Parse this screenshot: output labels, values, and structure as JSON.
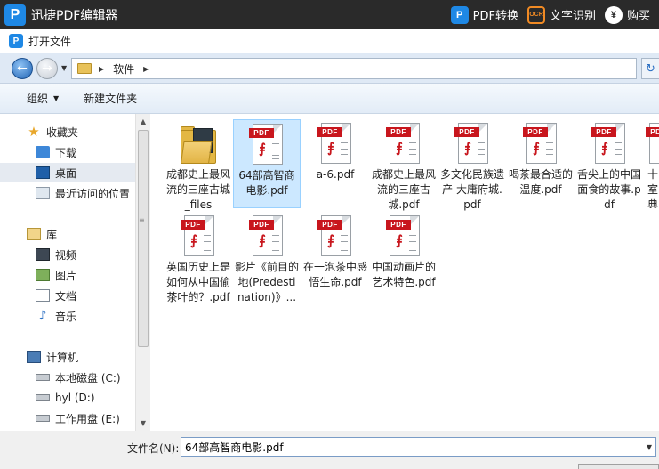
{
  "app": {
    "logo_letter": "P",
    "title": "迅捷PDF编辑器",
    "pdf_convert": "PDF转换",
    "ocr": "文字识别",
    "ocr_badge": "OCR",
    "buy": "购买",
    "buy_symbol": "¥"
  },
  "dialog": {
    "title": "打开文件"
  },
  "address": {
    "path": "软件"
  },
  "toolbar": {
    "organize": "组织",
    "new_folder": "新建文件夹"
  },
  "nav": {
    "items": [
      {
        "label": "收藏夹",
        "icon": "star-icon"
      },
      {
        "label": "下载",
        "icon": "download-folder-icon"
      },
      {
        "label": "桌面",
        "icon": "desktop-icon"
      },
      {
        "label": "最近访问的位置",
        "icon": "recent-places-icon"
      },
      {
        "label": "库",
        "icon": "library-icon"
      },
      {
        "label": "视频",
        "icon": "video-icon"
      },
      {
        "label": "图片",
        "icon": "picture-icon"
      },
      {
        "label": "文档",
        "icon": "document-icon"
      },
      {
        "label": "音乐",
        "icon": "music-icon"
      },
      {
        "label": "计算机",
        "icon": "computer-icon"
      },
      {
        "label": "本地磁盘 (C:)",
        "icon": "disk-icon"
      },
      {
        "label": "hyl (D:)",
        "icon": "disk-icon"
      },
      {
        "label": "工作用盘 (E:)",
        "icon": "disk-icon"
      }
    ]
  },
  "files": [
    {
      "name": "成都史上最风流的三座古城_files",
      "type": "folder"
    },
    {
      "name": "64部高智商电影.pdf",
      "type": "pdf"
    },
    {
      "name": "a-6.pdf",
      "type": "pdf"
    },
    {
      "name": "成都史上最风流的三座古城.pdf",
      "type": "pdf"
    },
    {
      "name": "多文化民族遗产 大庸府城.pdf",
      "type": "pdf"
    },
    {
      "name": "喝茶最合适的温度.pdf",
      "type": "pdf"
    },
    {
      "name": "舌尖上的中国面食的故事.pdf",
      "type": "pdf"
    },
    {
      "name": "十室典",
      "type": "pdf"
    },
    {
      "name": "英国历史上是如何从中国偷茶叶的？.pdf",
      "type": "pdf"
    },
    {
      "name": "影片《前目的地(Predestination)》...",
      "type": "pdf"
    },
    {
      "name": "在一泡茶中感悟生命.pdf",
      "type": "pdf"
    },
    {
      "name": "中国动画片的艺术特色.pdf",
      "type": "pdf"
    }
  ],
  "pdf_badge": "PDF",
  "filename": {
    "label": "文件名(N):",
    "value": "64部高智商电影.pdf"
  }
}
